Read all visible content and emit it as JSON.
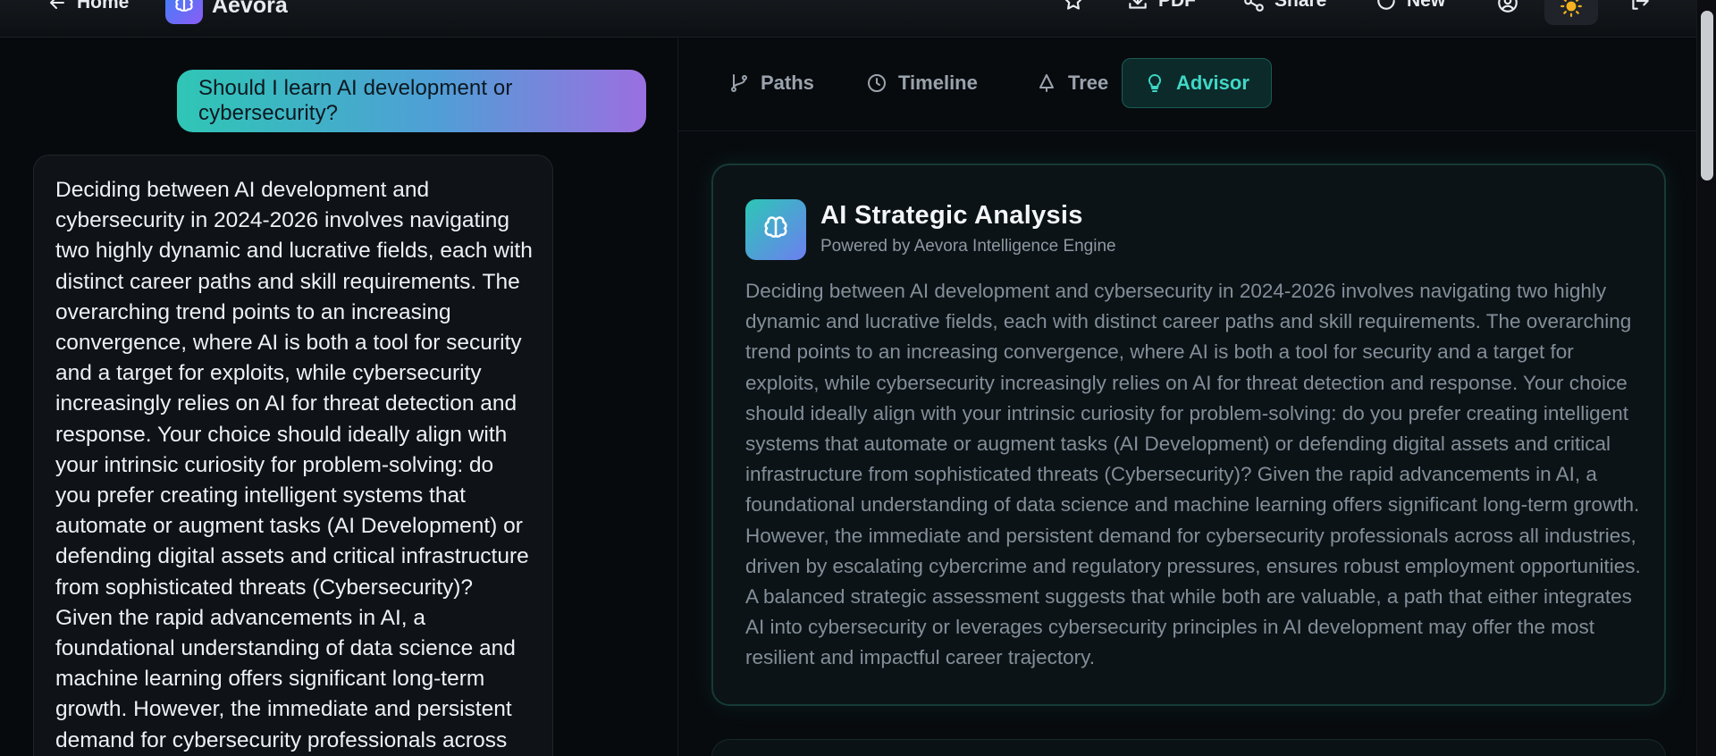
{
  "header": {
    "home_label": "Home",
    "brand_name": "Aevora",
    "pdf_label": "PDF",
    "share_label": "Share",
    "new_label": "New"
  },
  "chat": {
    "user_message": "Should I learn AI development or cybersecurity?",
    "ai_message": "Deciding between AI development and cybersecurity in 2024-2026 involves navigating two highly dynamic and lucrative fields, each with distinct career paths and skill requirements. The overarching trend points to an increasing convergence, where AI is both a tool for security and a target for exploits, while cybersecurity increasingly relies on AI for threat detection and response. Your choice should ideally align with your intrinsic curiosity for problem-solving: do you prefer creating intelligent systems that automate or augment tasks (AI Development) or defending digital assets and critical infrastructure from sophisticated threats (Cybersecurity)? Given the rapid advancements in AI, a foundational understanding of data science and machine learning offers significant long-term growth. However, the immediate and persistent demand for cybersecurity professionals across all industries, driven by escalating cybercrime and regulatory pressures,"
  },
  "tabs": [
    {
      "label": "Paths",
      "icon": "git-branch-icon"
    },
    {
      "label": "Timeline",
      "icon": "clock-icon"
    },
    {
      "label": "Tree",
      "icon": "tree-icon"
    },
    {
      "label": "Advisor",
      "icon": "lightbulb-icon",
      "active": true
    }
  ],
  "analysis": {
    "title": "AI Strategic Analysis",
    "subtitle": "Powered by Aevora Intelligence Engine",
    "body": "Deciding between AI development and cybersecurity in 2024-2026 involves navigating two highly dynamic and lucrative fields, each with distinct career paths and skill requirements. The overarching trend points to an increasing convergence, where AI is both a tool for security and a target for exploits, while cybersecurity increasingly relies on AI for threat detection and response. Your choice should ideally align with your intrinsic curiosity for problem-solving: do you prefer creating intelligent systems that automate or augment tasks (AI Development) or defending digital assets and critical infrastructure from sophisticated threats (Cybersecurity)? Given the rapid advancements in AI, a foundational understanding of data science and machine learning offers significant long-term growth. However, the immediate and persistent demand for cybersecurity professionals across all industries, driven by escalating cybercrime and regulatory pressures, ensures robust employment opportunities. A balanced strategic assessment suggests that while both are valuable, a path that either integrates AI into cybersecurity or leverages cybersecurity principles in AI development may offer the most resilient and impactful career trajectory."
  },
  "colors": {
    "accent": "#3fd7c6",
    "brand_gradient_start": "#2fc6b5",
    "brand_gradient_end": "#9b6fe0",
    "background": "#070a0c"
  }
}
